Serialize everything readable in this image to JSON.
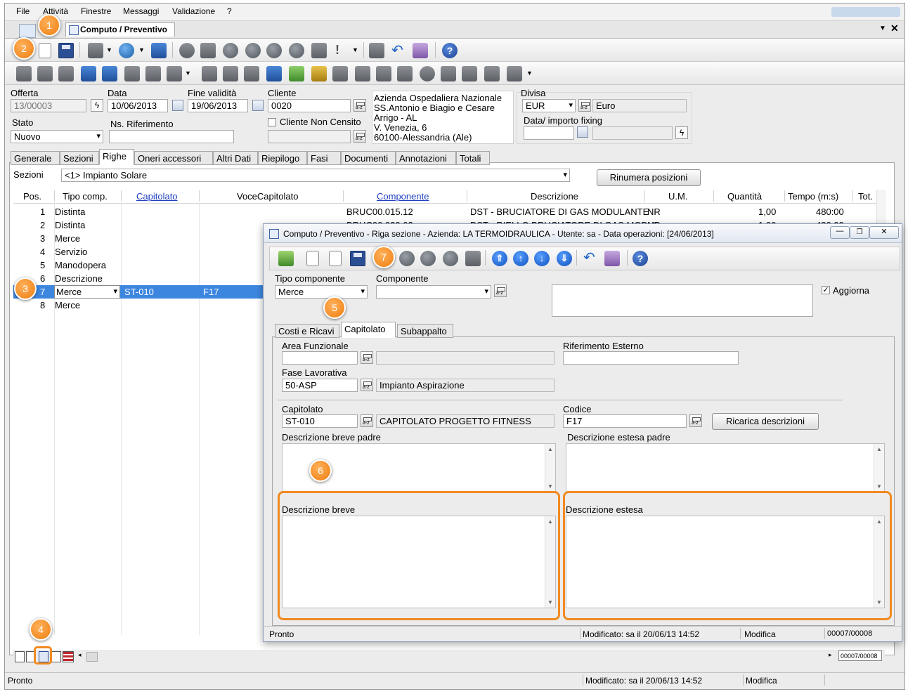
{
  "menu": [
    "File",
    "Attività",
    "Finestre",
    "Messaggi",
    "Validazione",
    "?"
  ],
  "doc_tab": {
    "label": "Computo / Preventivo"
  },
  "header": {
    "offerta_label": "Offerta",
    "offerta_value": "13/00003",
    "data_label": "Data",
    "data_value": "10/06/2013",
    "fine_label": "Fine validità",
    "fine_value": "19/06/2013",
    "cliente_label": "Cliente",
    "cliente_value": "0020",
    "cliente_non_censito_label": "Cliente Non Censito",
    "stato_label": "Stato",
    "stato_value": "Nuovo",
    "ns_rif_label": "Ns. Riferimento",
    "address": [
      "Azienda Ospedaliera Nazionale",
      "SS.Antonio e Biagio e Cesare",
      "Arrigo - AL",
      "V. Venezia, 6",
      "60100-Alessandria (Ale)"
    ],
    "divisa_label": "Divisa",
    "divisa_code": "EUR",
    "divisa_name": "Euro",
    "fixing_label": "Data/ importo fixing"
  },
  "main_tabs": [
    "Generale",
    "Sezioni",
    "Righe",
    "Oneri accessori",
    "Altri Dati",
    "Riepilogo",
    "Fasi",
    "Documenti",
    "Annotazioni",
    "Totali"
  ],
  "sezioni": {
    "label": "Sezioni",
    "value": "<1> Impianto Solare",
    "rinumera_label": "Rinumera posizioni"
  },
  "grid": {
    "headers": [
      "Pos.",
      "Tipo comp.",
      "Capitolato",
      "VoceCapitolato",
      "Componente",
      "Descrizione",
      "U.M.",
      "Quantità",
      "Tempo (m:s)",
      "Tot."
    ],
    "rows": [
      {
        "pos": "1",
        "tipo": "Distinta",
        "cap": "",
        "voce": "",
        "comp": "BRUC00.015.12",
        "desc": "DST - BRUCIATORE DI GAS MODULANTE",
        "um": "NR",
        "qta": "1,00",
        "tempo": "480:00"
      },
      {
        "pos": "2",
        "tipo": "Distinta",
        "cap": "",
        "voce": "",
        "comp": "BRUC00.030.02",
        "desc": "DST - RIELLO BRUCIATORE DI GAS MODUL",
        "um": "NR",
        "qta": "1,00",
        "tempo": "480:00"
      },
      {
        "pos": "3",
        "tipo": "Merce",
        "cap": "",
        "voce": "",
        "comp": "",
        "desc": "",
        "um": "",
        "qta": "",
        "tempo": ""
      },
      {
        "pos": "4",
        "tipo": "Servizio",
        "cap": "",
        "voce": "",
        "comp": "",
        "desc": "",
        "um": "",
        "qta": "",
        "tempo": ""
      },
      {
        "pos": "5",
        "tipo": "Manodopera",
        "cap": "",
        "voce": "",
        "comp": "",
        "desc": "",
        "um": "",
        "qta": "",
        "tempo": ""
      },
      {
        "pos": "6",
        "tipo": "Descrizione",
        "cap": "",
        "voce": "",
        "comp": "",
        "desc": "",
        "um": "",
        "qta": "",
        "tempo": ""
      },
      {
        "pos": "7",
        "tipo": "Merce",
        "cap": "ST-010",
        "voce": "F17",
        "comp": "",
        "desc": "",
        "um": "",
        "qta": "",
        "tempo": ""
      },
      {
        "pos": "8",
        "tipo": "Merce",
        "cap": "",
        "voce": "",
        "comp": "",
        "desc": "",
        "um": "",
        "qta": "",
        "tempo": ""
      }
    ]
  },
  "main_status": {
    "left": "Pronto",
    "modified": "Modificato: sa il 20/06/13 14:52",
    "mode": "Modifica",
    "record": "00007/00008"
  },
  "child": {
    "title": "Computo / Preventivo - Riga sezione - Azienda: LA TERMOIDRAULICA - Utente: sa - Data operazioni: [24/06/2013]",
    "tipo_label": "Tipo componente",
    "tipo_value": "Merce",
    "componente_label": "Componente",
    "aggiorna_label": "Aggiorna",
    "tabs": [
      "Costi e Ricavi",
      "Capitolato",
      "Subappalto"
    ],
    "area_label": "Area Funzionale",
    "rif_label": "Riferimento Esterno",
    "fase_label": "Fase Lavorativa",
    "fase_value": "50-ASP",
    "fase_desc": "Impianto Aspirazione",
    "capitolato_label": "Capitolato",
    "capitolato_value": "ST-010",
    "capitolato_desc": "CAPITOLATO PROGETTO FITNESS",
    "codice_label": "Codice",
    "codice_value": "F17",
    "ricarica_label": "Ricarica descrizioni",
    "desc_breve_padre": "Descrizione breve padre",
    "desc_estesa_padre": "Descrizione estesa padre",
    "desc_breve": "Descrizione breve",
    "desc_estesa": "Descrizione estesa",
    "status": {
      "left": "Pronto",
      "modified": "Modificato: sa il 20/06/13 14:52",
      "mode": "Modifica",
      "record": "00007/00008"
    }
  },
  "badges": [
    "1",
    "2",
    "3",
    "4",
    "5",
    "6",
    "7"
  ],
  "colors": {
    "accent_orange": "#f08a22",
    "selection_blue": "#3d86e0",
    "link_blue": "#1f3fbf"
  }
}
